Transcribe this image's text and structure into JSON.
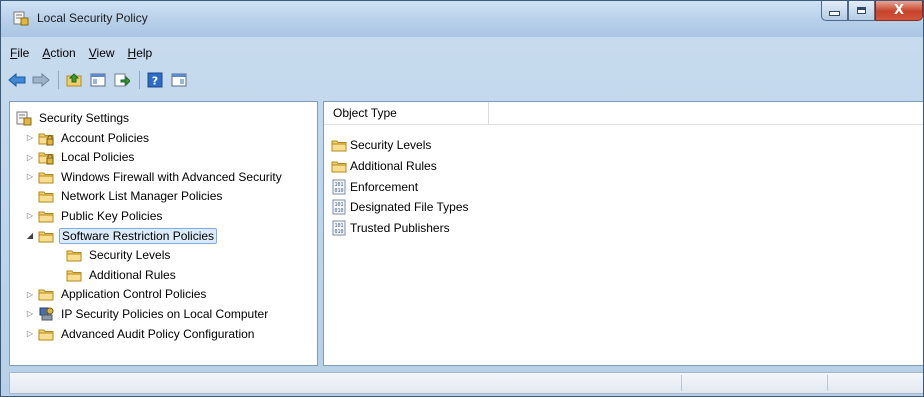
{
  "window": {
    "title": "Local Security Policy",
    "controls": {
      "minimize": "minimize",
      "maximize": "maximize",
      "close": "X"
    }
  },
  "menubar": {
    "items": [
      {
        "accel": "F",
        "rest": "ile"
      },
      {
        "accel": "A",
        "rest": "ction"
      },
      {
        "accel": "V",
        "rest": "iew"
      },
      {
        "accel": "H",
        "rest": "elp"
      }
    ]
  },
  "toolbar": {
    "icons": [
      "back-arrow-icon",
      "forward-arrow-icon",
      "up-folder-icon",
      "show-hide-console-tree-icon",
      "export-list-icon",
      "help-icon",
      "show-hide-action-pane-icon"
    ]
  },
  "tree": {
    "root": "Security Settings",
    "items": [
      {
        "label": "Account Policies",
        "expander": "collapsed",
        "icon": "locked-folder-icon"
      },
      {
        "label": "Local Policies",
        "expander": "collapsed",
        "icon": "locked-folder-icon"
      },
      {
        "label": "Windows Firewall with Advanced Security",
        "expander": "collapsed",
        "icon": "folder-icon"
      },
      {
        "label": "Network List Manager Policies",
        "expander": "none",
        "icon": "folder-icon"
      },
      {
        "label": "Public Key Policies",
        "expander": "collapsed",
        "icon": "folder-icon"
      },
      {
        "label": "Software Restriction Policies",
        "expander": "expanded",
        "icon": "folder-icon",
        "selected": true
      },
      {
        "label": "Security Levels",
        "expander": "none",
        "icon": "folder-icon",
        "child": true
      },
      {
        "label": "Additional Rules",
        "expander": "none",
        "icon": "folder-icon",
        "child": true
      },
      {
        "label": "Application Control Policies",
        "expander": "collapsed",
        "icon": "folder-icon"
      },
      {
        "label": "IP Security Policies on Local Computer",
        "expander": "collapsed",
        "icon": "ip-security-icon"
      },
      {
        "label": "Advanced Audit Policy Configuration",
        "expander": "collapsed",
        "icon": "folder-icon"
      }
    ]
  },
  "list": {
    "column_header": "Object Type",
    "items": [
      {
        "label": "Security Levels",
        "icon": "folder-icon"
      },
      {
        "label": "Additional Rules",
        "icon": "folder-icon"
      },
      {
        "label": "Enforcement",
        "icon": "policy-setting-icon"
      },
      {
        "label": "Designated File Types",
        "icon": "policy-setting-icon"
      },
      {
        "label": "Trusted Publishers",
        "icon": "policy-setting-icon"
      }
    ]
  },
  "colors": {
    "selection_bg": "#dcebfc",
    "selection_border": "#84acdd",
    "folder": "#f2cf6a",
    "close_button": "#c7432a"
  }
}
